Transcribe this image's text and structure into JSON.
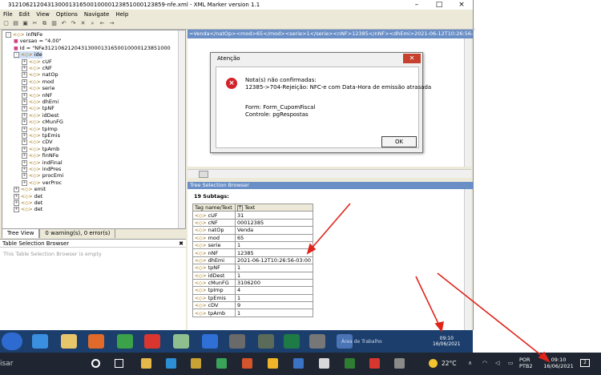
{
  "window": {
    "title": "31210621204313000131650010000123851000123859-nfe.xml - XML Marker version 1.1"
  },
  "menu": [
    "File",
    "Edit",
    "View",
    "Options",
    "Navigate",
    "Help"
  ],
  "tree": {
    "nodes": [
      {
        "label": "infNFe",
        "depth": 1,
        "kind": "element",
        "expand": "-"
      },
      {
        "label": "versao = \"4.00\"",
        "depth": 2,
        "kind": "attr",
        "expand": ""
      },
      {
        "label": "Id = \"NFe31210621204313000131650010000123851000",
        "depth": 2,
        "kind": "attr",
        "expand": ""
      },
      {
        "label": "ide",
        "depth": 2,
        "kind": "element",
        "expand": "-",
        "selected": true
      },
      {
        "label": "cUF",
        "depth": 3,
        "kind": "element",
        "expand": "+"
      },
      {
        "label": "cNF",
        "depth": 3,
        "kind": "element",
        "expand": "+"
      },
      {
        "label": "natOp",
        "depth": 3,
        "kind": "element",
        "expand": "+"
      },
      {
        "label": "mod",
        "depth": 3,
        "kind": "element",
        "expand": "+"
      },
      {
        "label": "serie",
        "depth": 3,
        "kind": "element",
        "expand": "+"
      },
      {
        "label": "nNF",
        "depth": 3,
        "kind": "element",
        "expand": "+"
      },
      {
        "label": "dhEmi",
        "depth": 3,
        "kind": "element",
        "expand": "+"
      },
      {
        "label": "tpNF",
        "depth": 3,
        "kind": "element",
        "expand": "+"
      },
      {
        "label": "idDest",
        "depth": 3,
        "kind": "element",
        "expand": "+"
      },
      {
        "label": "cMunFG",
        "depth": 3,
        "kind": "element",
        "expand": "+"
      },
      {
        "label": "tpImp",
        "depth": 3,
        "kind": "element",
        "expand": "+"
      },
      {
        "label": "tpEmis",
        "depth": 3,
        "kind": "element",
        "expand": "+"
      },
      {
        "label": "cDV",
        "depth": 3,
        "kind": "element",
        "expand": "+"
      },
      {
        "label": "tpAmb",
        "depth": 3,
        "kind": "element",
        "expand": "+"
      },
      {
        "label": "finNFe",
        "depth": 3,
        "kind": "element",
        "expand": "+"
      },
      {
        "label": "indFinal",
        "depth": 3,
        "kind": "element",
        "expand": "+"
      },
      {
        "label": "indPres",
        "depth": 3,
        "kind": "element",
        "expand": "+"
      },
      {
        "label": "procEmi",
        "depth": 3,
        "kind": "element",
        "expand": "+"
      },
      {
        "label": "verProc",
        "depth": 3,
        "kind": "element",
        "expand": "+"
      },
      {
        "label": "emit",
        "depth": 2,
        "kind": "element",
        "expand": "+"
      },
      {
        "label": "det",
        "depth": 2,
        "kind": "element",
        "expand": "+"
      },
      {
        "label": "det",
        "depth": 2,
        "kind": "element",
        "expand": "+"
      },
      {
        "label": "det",
        "depth": 2,
        "kind": "element",
        "expand": "+"
      }
    ]
  },
  "tabs": {
    "tree_view": "Tree View",
    "warnings": "0 warning(s), 0 error(s)"
  },
  "table_browser": {
    "title": "Table Selection Browser",
    "empty": "This Table Selection Browser is empty"
  },
  "xml_bar": "=Venda</natOp><mod>65</mod><serie>1</serie><nNF>12385</nNF><dhEmi>2021-06-12T10:26:56-03:00</d",
  "dialog": {
    "title": "Atenção",
    "line1": "Nota(s) não confirmadas:",
    "line2": "12385->704-Rejeição: NFC-e com Data-Hora de emissão atrasada",
    "line3": "Form: Form_CupomFiscal",
    "line4": "Controle: pgRespostas",
    "ok": "OK"
  },
  "tree_selection": {
    "title": "Tree Selection Browser",
    "subtags": "19 Subtags:",
    "col1": "Tag name/Text",
    "col2": "Text",
    "rows": [
      {
        "tag": "cUF",
        "text": "31"
      },
      {
        "tag": "cNF",
        "text": "00012385"
      },
      {
        "tag": "natOp",
        "text": "Venda"
      },
      {
        "tag": "mod",
        "text": "65"
      },
      {
        "tag": "serie",
        "text": "1"
      },
      {
        "tag": "nNF",
        "text": "12385"
      },
      {
        "tag": "dhEmi",
        "text": "2021-06-12T10:26:56-03:00"
      },
      {
        "tag": "tpNF",
        "text": "1"
      },
      {
        "tag": "idDest",
        "text": "1"
      },
      {
        "tag": "cMunFG",
        "text": "3106200"
      },
      {
        "tag": "tpImp",
        "text": "4"
      },
      {
        "tag": "tpEmis",
        "text": "1"
      },
      {
        "tag": "cDV",
        "text": "9"
      },
      {
        "tag": "tpAmb",
        "text": "1"
      }
    ]
  },
  "inner_taskbar": {
    "area": "Área de Trabalho",
    "time": "09:10",
    "date": "16/06/2021"
  },
  "taskbar": {
    "search": "isar",
    "weather": "22°C",
    "lang1": "POR",
    "lang2": "PTB2",
    "time": "09:10",
    "date": "16/06/2021",
    "notif": "2"
  },
  "colors": {
    "accent_bar": "#6a8fc7",
    "error": "#d2232a",
    "arrow": "#e0241b"
  }
}
